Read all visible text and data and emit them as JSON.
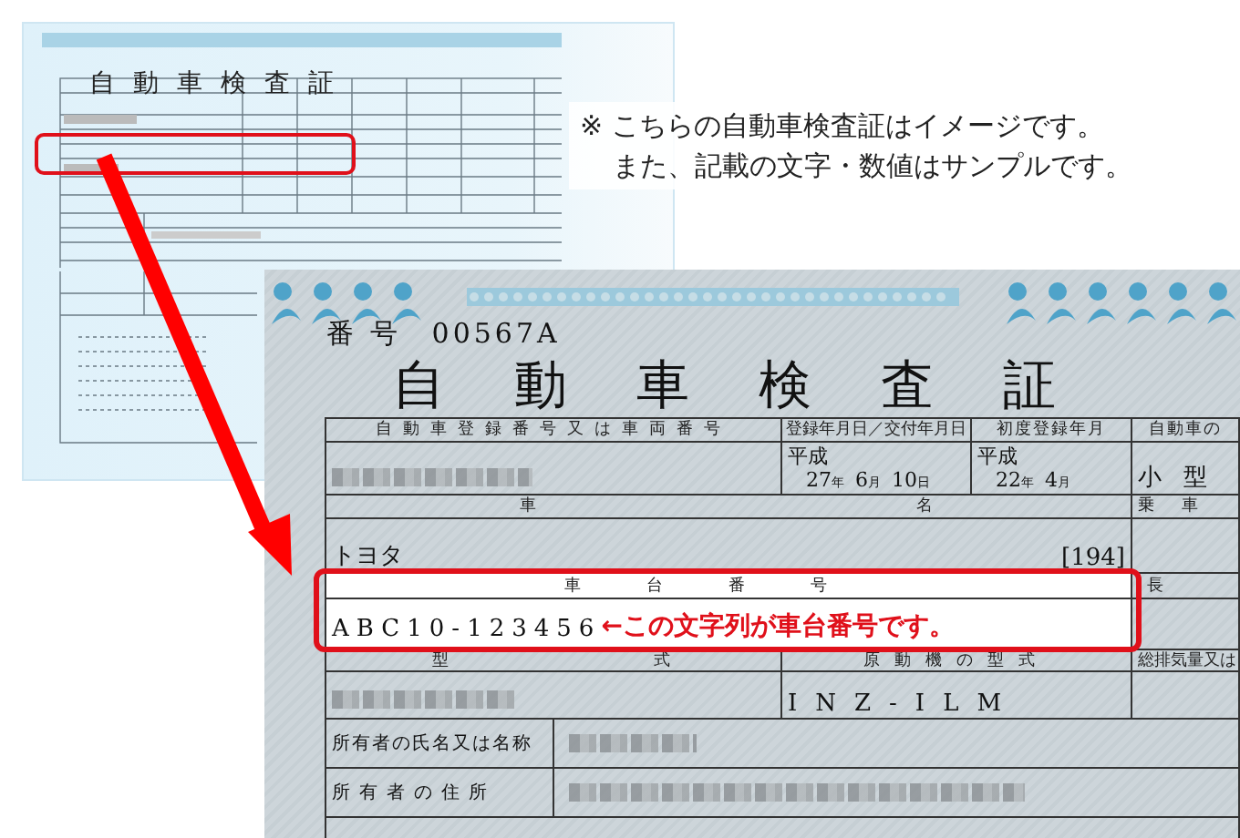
{
  "thumbnail": {
    "title": "自動車検査証",
    "highlighted": true
  },
  "note_lines": [
    "※ こちらの自動車検査証はイメージです。",
    "また、記載の文字・数値はサンプルです。"
  ],
  "certificate": {
    "number_label": "番 号",
    "number": "00567A",
    "title": "自動車検査証",
    "registration_number_header": "自動車登録番号又は車両番号",
    "registration_date_header": "登録年月日／交付年月日",
    "registration_date": {
      "era": "平成",
      "parts": [
        {
          "value": "27",
          "unit": "年"
        },
        {
          "value": "6",
          "unit": "月"
        },
        {
          "value": "10",
          "unit": "日"
        }
      ]
    },
    "first_registration_header": "初度登録年月",
    "first_registration": {
      "era": "平成",
      "parts": [
        {
          "value": "22",
          "unit": "年"
        },
        {
          "value": "4",
          "unit": "月"
        }
      ]
    },
    "column_4_header": "自動車の",
    "column_4_value": "小 型",
    "car_name_header": [
      "車",
      "名"
    ],
    "seating_header": "乗 車",
    "car_name": "トヨタ",
    "car_name_code": "[194]",
    "chassis": {
      "header": "車台番号",
      "value": "ABC10-123456",
      "callout": "←この文字列が車台番号です。",
      "highlighted": true
    },
    "length_header": "長",
    "model_header": [
      "型",
      "式"
    ],
    "engine_model_header": "原動機の型式",
    "displacement_header": "総排気量又は",
    "engine_model": "INZ-ILM",
    "owner_name_label": "所有者の氏名又は名称",
    "owner_address_label": "所有者の住所"
  }
}
